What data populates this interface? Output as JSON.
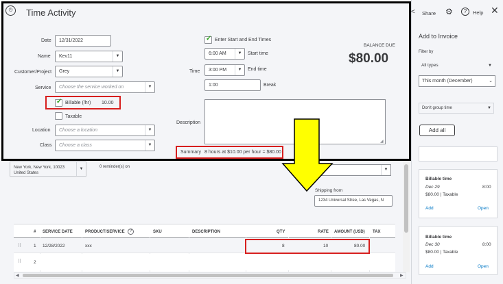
{
  "time_activity": {
    "title": "Time Activity",
    "date_label": "Date",
    "date_value": "12/31/2022",
    "name_label": "Name",
    "name_value": "Kev11",
    "customer_label": "Customer/Project",
    "customer_value": "Grey",
    "service_label": "Service",
    "service_placeholder": "Choose the service worked on",
    "billable_label": "Billable (/hr)",
    "billable_rate": "10.00",
    "taxable_label": "Taxable",
    "location_label": "Location",
    "location_placeholder": "Choose a location",
    "class_label": "Class",
    "class_placeholder": "Choose a class",
    "enter_times_label": "Enter Start and End Times",
    "time_label": "Time",
    "start_time": "6:00 AM",
    "start_time_label": "Start time",
    "end_time": "3:00 PM",
    "end_time_label": "End time",
    "break_value": "1:00",
    "break_label": "Break",
    "description_label": "Description",
    "balance_due_label": "BALANCE DUE",
    "balance_due": "$80.00",
    "summary_label": "Summary",
    "summary_text": "8 hours at $10.00 per hour = $80.00"
  },
  "invoice": {
    "address_line1": "New York, New York, 10023",
    "address_line2": "United States",
    "reminders": "0 reminder(s) on",
    "shipping_from_label": "Shipping from",
    "shipping_from_value": "1234 Universal Stree, Las Vegas, N",
    "columns": [
      "#",
      "SERVICE DATE",
      "PRODUCT/SERVICE",
      "SKU",
      "DESCRIPTION",
      "QTY",
      "RATE",
      "AMOUNT (USD)",
      "TAX"
    ],
    "rows": [
      {
        "num": "1",
        "date": "12/28/2022",
        "product": "xxx",
        "qty": "8",
        "rate": "10",
        "amount": "80.00"
      },
      {
        "num": "2",
        "date": "",
        "product": "",
        "qty": "",
        "rate": "",
        "amount": ""
      }
    ]
  },
  "sidebar": {
    "share_label": "Share",
    "help_label": "Help",
    "title": "Add to Invoice",
    "filter_by_label": "Filter by",
    "filter_type": "All types",
    "filter_date": "This month (December)",
    "group_by": "Don't group time",
    "add_all_label": "Add all",
    "cards": [
      {
        "title": "Billable time",
        "date": "Dec 29",
        "time": "8:00",
        "amount": "$80.00 | Taxable",
        "add": "Add",
        "open": "Open"
      },
      {
        "title": "Billable time",
        "date": "Dec 30",
        "time": "8:00",
        "amount": "$80.00 | Taxable",
        "add": "Add",
        "open": "Open"
      }
    ]
  },
  "colors": {
    "accent_green": "#2ca01c",
    "link_blue": "#0077c5",
    "highlight_red": "#d71e1e",
    "arrow_yellow": "#ffff00"
  }
}
